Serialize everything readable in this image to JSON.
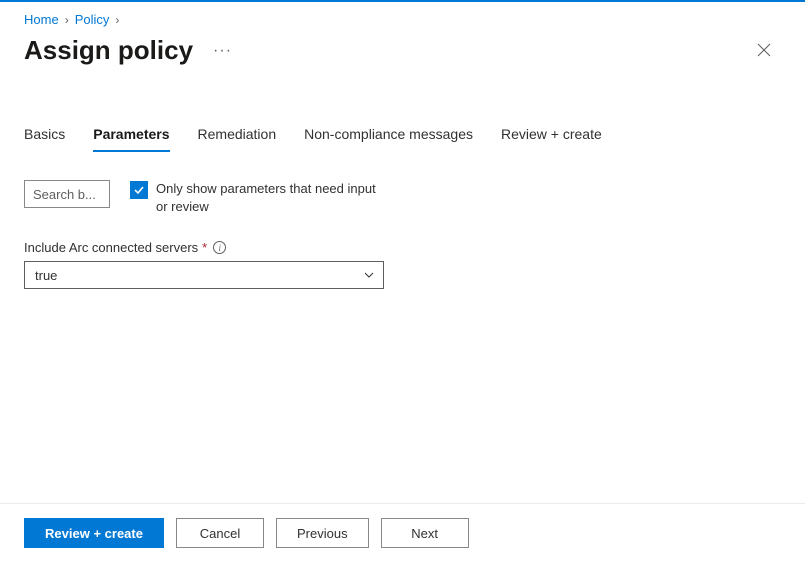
{
  "breadcrumb": {
    "items": [
      {
        "label": "Home"
      },
      {
        "label": "Policy"
      }
    ]
  },
  "pageTitle": "Assign policy",
  "tabs": {
    "basics": "Basics",
    "parameters": "Parameters",
    "remediation": "Remediation",
    "nonCompliance": "Non-compliance messages",
    "reviewCreate": "Review + create"
  },
  "search": {
    "placeholder": "Search b..."
  },
  "filterCheckbox": {
    "label": "Only show parameters that need input or review",
    "checked": true
  },
  "parameter": {
    "label": "Include Arc connected servers",
    "required": "*",
    "value": "true"
  },
  "footer": {
    "reviewCreate": "Review + create",
    "cancel": "Cancel",
    "previous": "Previous",
    "next": "Next"
  }
}
